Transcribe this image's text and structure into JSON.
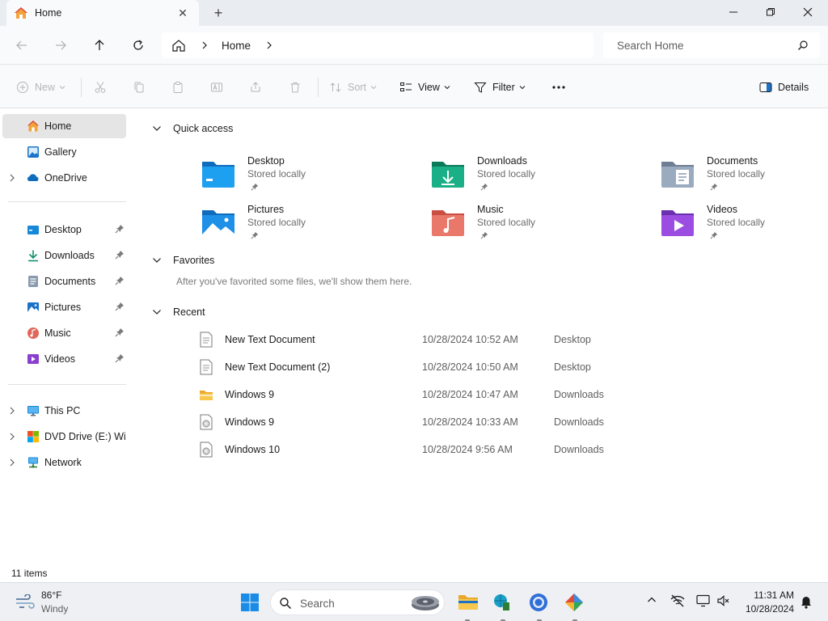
{
  "window": {
    "tab_title": "Home",
    "new_tab_label": "+"
  },
  "address": {
    "breadcrumb": [
      "Home"
    ],
    "search_placeholder": "Search Home"
  },
  "commands": {
    "new": "New",
    "sort": "Sort",
    "view": "View",
    "filter": "Filter",
    "details": "Details"
  },
  "sidebar": {
    "top": [
      {
        "label": "Home",
        "icon": "home-icon",
        "active": true
      },
      {
        "label": "Gallery",
        "icon": "gallery-icon"
      },
      {
        "label": "OneDrive",
        "icon": "onedrive-icon",
        "expandable": true
      }
    ],
    "pinned": [
      {
        "label": "Desktop",
        "icon": "desktop-folder-icon"
      },
      {
        "label": "Downloads",
        "icon": "downloads-folder-icon"
      },
      {
        "label": "Documents",
        "icon": "documents-folder-icon"
      },
      {
        "label": "Pictures",
        "icon": "pictures-folder-icon"
      },
      {
        "label": "Music",
        "icon": "music-folder-icon"
      },
      {
        "label": "Videos",
        "icon": "videos-folder-icon"
      }
    ],
    "devices": [
      {
        "label": "This PC",
        "icon": "this-pc-icon"
      },
      {
        "label": "DVD Drive (E:) Windows",
        "icon": "dvd-drive-icon"
      },
      {
        "label": "Network",
        "icon": "network-icon"
      }
    ]
  },
  "quick_access": {
    "title": "Quick access",
    "items": [
      {
        "name": "Desktop",
        "sub": "Stored locally",
        "icon": "desktop-folder-icon"
      },
      {
        "name": "Downloads",
        "sub": "Stored locally",
        "icon": "downloads-folder-icon"
      },
      {
        "name": "Documents",
        "sub": "Stored locally",
        "icon": "documents-folder-icon"
      },
      {
        "name": "Pictures",
        "sub": "Stored locally",
        "icon": "pictures-folder-icon"
      },
      {
        "name": "Music",
        "sub": "Stored locally",
        "icon": "music-folder-icon"
      },
      {
        "name": "Videos",
        "sub": "Stored locally",
        "icon": "videos-folder-icon"
      }
    ]
  },
  "favorites": {
    "title": "Favorites",
    "empty_text": "After you've favorited some files, we'll show them here."
  },
  "recent": {
    "title": "Recent",
    "items": [
      {
        "name": "New Text Document",
        "date": "10/28/2024 10:52 AM",
        "location": "Desktop",
        "icon": "text-document-icon"
      },
      {
        "name": "New Text Document (2)",
        "date": "10/28/2024 10:50 AM",
        "location": "Desktop",
        "icon": "text-document-icon"
      },
      {
        "name": "Windows 9",
        "date": "10/28/2024 10:47 AM",
        "location": "Downloads",
        "icon": "folder-icon"
      },
      {
        "name": "Windows 9",
        "date": "10/28/2024 10:33 AM",
        "location": "Downloads",
        "icon": "disc-image-icon"
      },
      {
        "name": "Windows 10",
        "date": "10/28/2024 9:56 AM",
        "location": "Downloads",
        "icon": "disc-image-icon"
      }
    ]
  },
  "status": {
    "item_count": "11 items"
  },
  "taskbar": {
    "weather_temp": "86°F",
    "weather_condition": "Windy",
    "search_label": "Search",
    "time": "11:31 AM",
    "date": "10/28/2024"
  }
}
